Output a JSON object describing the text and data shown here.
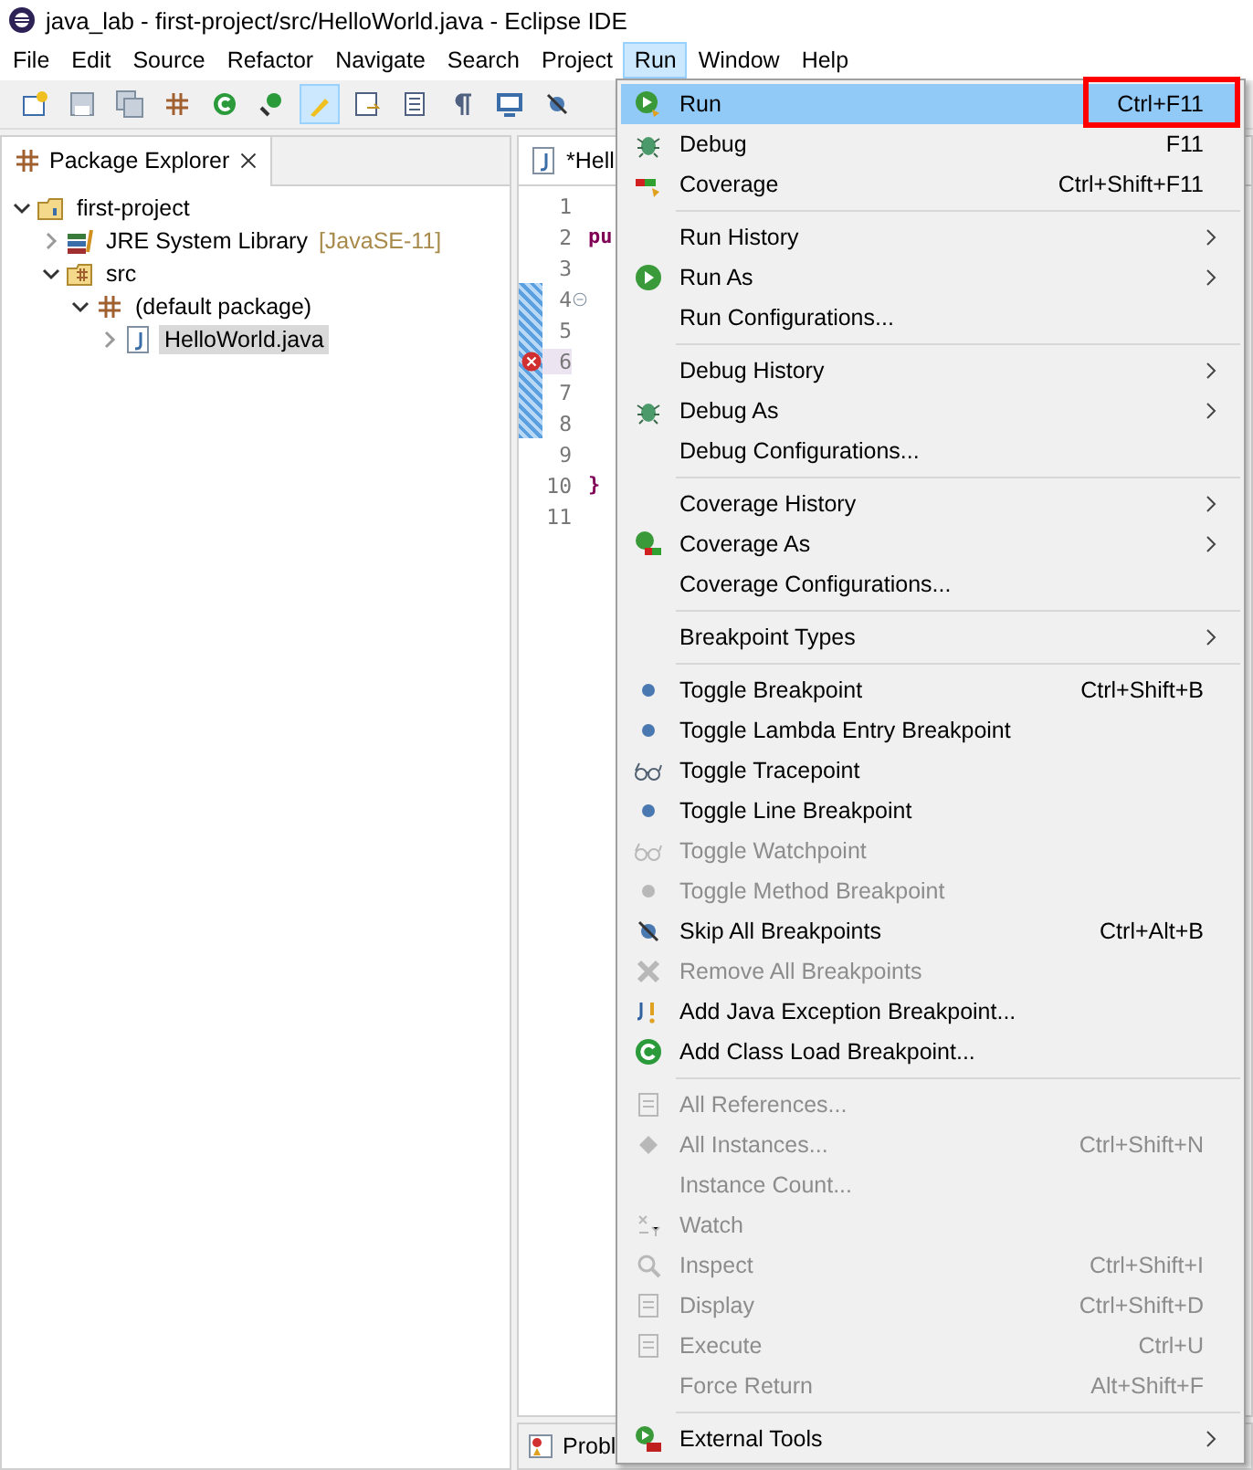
{
  "window": {
    "title": "java_lab - first-project/src/HelloWorld.java - Eclipse IDE"
  },
  "menubar": [
    {
      "label": "File",
      "selected": false
    },
    {
      "label": "Edit",
      "selected": false
    },
    {
      "label": "Source",
      "selected": false
    },
    {
      "label": "Refactor",
      "selected": false
    },
    {
      "label": "Navigate",
      "selected": false
    },
    {
      "label": "Search",
      "selected": false
    },
    {
      "label": "Project",
      "selected": false
    },
    {
      "label": "Run",
      "selected": true
    },
    {
      "label": "Window",
      "selected": false
    },
    {
      "label": "Help",
      "selected": false
    }
  ],
  "toolbar": [
    {
      "selected": false
    },
    {
      "selected": false
    },
    {
      "selected": false
    },
    {
      "selected": false
    },
    {
      "selected": false
    },
    {
      "selected": false
    },
    {
      "selected": true
    },
    {
      "selected": false
    },
    {
      "selected": false
    },
    {
      "selected": false
    },
    {
      "selected": false
    },
    {
      "selected": false
    }
  ],
  "package_explorer": {
    "title": "Package Explorer",
    "tree": [
      {
        "label": "first-project",
        "kind": "project",
        "expanded": true,
        "selected": false,
        "children": [
          {
            "label": "JRE System Library",
            "suffix": "[JavaSE-11]",
            "kind": "library",
            "expanded": false,
            "selected": false
          },
          {
            "label": "src",
            "kind": "folder",
            "expanded": true,
            "selected": false,
            "children": [
              {
                "label": "(default package)",
                "kind": "package",
                "expanded": true,
                "selected": false,
                "children": [
                  {
                    "label": "HelloWorld.java",
                    "kind": "java",
                    "expanded": false,
                    "selected": true
                  }
                ]
              }
            ]
          }
        ]
      }
    ]
  },
  "editor": {
    "tab": "*Hell",
    "lines": [
      {
        "number": "1",
        "changed": false,
        "error": false,
        "fold": false
      },
      {
        "number": "2",
        "code": "pu",
        "changed": false,
        "error": false,
        "fold": false
      },
      {
        "number": "3",
        "changed": false,
        "error": false,
        "fold": false
      },
      {
        "number": "4",
        "changed": true,
        "error": false,
        "fold": true
      },
      {
        "number": "5",
        "changed": true,
        "error": false,
        "fold": false
      },
      {
        "number": "6",
        "changed": true,
        "error": true,
        "fold": false
      },
      {
        "number": "7",
        "changed": true,
        "error": false,
        "fold": false
      },
      {
        "number": "8",
        "changed": true,
        "error": false,
        "fold": false
      },
      {
        "number": "9",
        "changed": false,
        "error": false,
        "fold": false
      },
      {
        "number": "10",
        "code": "}",
        "changed": false,
        "error": false,
        "fold": false
      },
      {
        "number": "11",
        "changed": false,
        "error": false,
        "fold": false
      }
    ],
    "bottom_tab": "Probl"
  },
  "run_menu": [
    {
      "kind": "run",
      "label": "Run",
      "shortcut": "Ctrl+F11",
      "submenu": false,
      "disabled": false,
      "selected": true,
      "marked": true
    },
    {
      "kind": "debug",
      "label": "Debug",
      "shortcut": "F11",
      "submenu": false,
      "disabled": false,
      "selected": false,
      "marked": false
    },
    {
      "kind": "coverage",
      "label": "Coverage",
      "shortcut": "Ctrl+Shift+F11",
      "submenu": false,
      "disabled": false,
      "selected": false,
      "marked": false
    },
    {
      "kind": "separator"
    },
    {
      "kind": "plain",
      "label": "Run History",
      "submenu": true,
      "disabled": false,
      "selected": false,
      "marked": false
    },
    {
      "kind": "play",
      "label": "Run As",
      "submenu": true,
      "disabled": false,
      "selected": false,
      "marked": false
    },
    {
      "kind": "plain",
      "label": "Run Configurations...",
      "submenu": false,
      "disabled": false,
      "selected": false,
      "marked": false
    },
    {
      "kind": "separator"
    },
    {
      "kind": "plain",
      "label": "Debug History",
      "submenu": true,
      "disabled": false,
      "selected": false,
      "marked": false
    },
    {
      "kind": "bug",
      "label": "Debug As",
      "submenu": true,
      "disabled": false,
      "selected": false,
      "marked": false
    },
    {
      "kind": "plain",
      "label": "Debug Configurations...",
      "submenu": false,
      "disabled": false,
      "selected": false,
      "marked": false
    },
    {
      "kind": "separator"
    },
    {
      "kind": "plain",
      "label": "Coverage History",
      "submenu": true,
      "disabled": false,
      "selected": false,
      "marked": false
    },
    {
      "kind": "coverageas",
      "label": "Coverage As",
      "submenu": true,
      "disabled": false,
      "selected": false,
      "marked": false
    },
    {
      "kind": "plain",
      "label": "Coverage Configurations...",
      "submenu": false,
      "disabled": false,
      "selected": false,
      "marked": false
    },
    {
      "kind": "separator"
    },
    {
      "kind": "plain",
      "label": "Breakpoint Types",
      "submenu": true,
      "disabled": false,
      "selected": false,
      "marked": false
    },
    {
      "kind": "separator"
    },
    {
      "kind": "dot",
      "label": "Toggle Breakpoint",
      "shortcut": "Ctrl+Shift+B",
      "submenu": false,
      "disabled": false,
      "selected": false,
      "marked": false
    },
    {
      "kind": "dot",
      "label": "Toggle Lambda Entry Breakpoint",
      "submenu": false,
      "disabled": false,
      "selected": false,
      "marked": false
    },
    {
      "kind": "glasses",
      "label": "Toggle Tracepoint",
      "submenu": false,
      "disabled": false,
      "selected": false,
      "marked": false
    },
    {
      "kind": "dot",
      "label": "Toggle Line Breakpoint",
      "submenu": false,
      "disabled": false,
      "selected": false,
      "marked": false
    },
    {
      "kind": "glasses",
      "label": "Toggle Watchpoint",
      "submenu": false,
      "disabled": true,
      "selected": false,
      "marked": false
    },
    {
      "kind": "dot",
      "label": "Toggle Method Breakpoint",
      "submenu": false,
      "disabled": true,
      "selected": false,
      "marked": false
    },
    {
      "kind": "skip",
      "label": "Skip All Breakpoints",
      "shortcut": "Ctrl+Alt+B",
      "submenu": false,
      "disabled": false,
      "selected": false,
      "marked": false
    },
    {
      "kind": "remove",
      "label": "Remove All Breakpoints",
      "submenu": false,
      "disabled": true,
      "selected": false,
      "marked": false
    },
    {
      "kind": "exception",
      "label": "Add Java Exception Breakpoint...",
      "submenu": false,
      "disabled": false,
      "selected": false,
      "marked": false
    },
    {
      "kind": "classload",
      "label": "Add Class Load Breakpoint...",
      "submenu": false,
      "disabled": false,
      "selected": false,
      "marked": false
    },
    {
      "kind": "separator"
    },
    {
      "kind": "doc",
      "label": "All References...",
      "submenu": false,
      "disabled": true,
      "selected": false,
      "marked": false
    },
    {
      "kind": "diamond",
      "label": "All Instances...",
      "shortcut": "Ctrl+Shift+N",
      "submenu": false,
      "disabled": true,
      "selected": false,
      "marked": false
    },
    {
      "kind": "plain",
      "label": "Instance Count...",
      "submenu": false,
      "disabled": true,
      "selected": false,
      "marked": false
    },
    {
      "kind": "xy",
      "label": "Watch",
      "submenu": false,
      "disabled": true,
      "selected": false,
      "marked": false
    },
    {
      "kind": "magnifier",
      "label": "Inspect",
      "shortcut": "Ctrl+Shift+I",
      "submenu": false,
      "disabled": true,
      "selected": false,
      "marked": false
    },
    {
      "kind": "doc",
      "label": "Display",
      "shortcut": "Ctrl+Shift+D",
      "submenu": false,
      "disabled": true,
      "selected": false,
      "marked": false
    },
    {
      "kind": "doc",
      "label": "Execute",
      "shortcut": "Ctrl+U",
      "submenu": false,
      "disabled": true,
      "selected": false,
      "marked": false
    },
    {
      "kind": "plain",
      "label": "Force Return",
      "shortcut": "Alt+Shift+F",
      "submenu": false,
      "disabled": true,
      "selected": false,
      "marked": false
    },
    {
      "kind": "separator"
    },
    {
      "kind": "tools",
      "label": "External Tools",
      "submenu": true,
      "disabled": false,
      "selected": false,
      "marked": false
    }
  ]
}
